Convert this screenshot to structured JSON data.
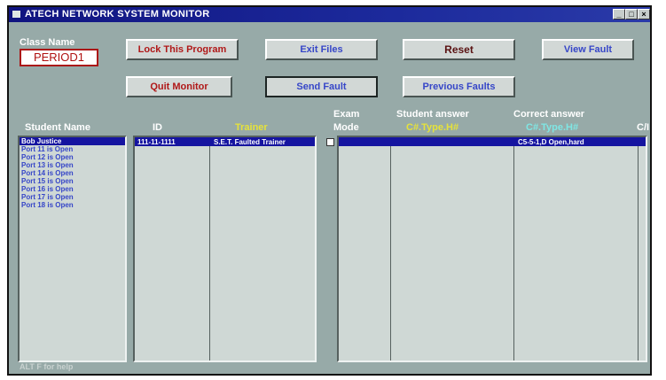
{
  "window": {
    "title": "ATECH NETWORK SYSTEM MONITOR"
  },
  "class_name": {
    "label": "Class Name",
    "value": "PERIOD1"
  },
  "buttons": {
    "lock": "Lock This Program",
    "exit_files": "Exit Files",
    "reset": "Reset",
    "view_fault": "View Fault",
    "quit": "Quit Monitor",
    "send_fault": "Send Fault",
    "previous_faults": "Previous Faults"
  },
  "headers": {
    "student_name": "Student Name",
    "id": "ID",
    "trainer": "Trainer",
    "exam": "Exam",
    "mode": "Mode",
    "student_answer": "Student answer",
    "student_answer_sub": "C#.Type.H#",
    "correct_answer": "Correct answer",
    "correct_answer_sub": "C#.Type.H#",
    "ca": "C/I"
  },
  "students": [
    "Bob Justice",
    "Port 11 is Open",
    "Port 12 is Open",
    "Port 13 is Open",
    "Port 14 is Open",
    "Port 15 is Open",
    "Port 16 is Open",
    "Port 17 is Open",
    "Port 18 is Open"
  ],
  "selected_row": {
    "id": "111-11-1111",
    "trainer": "S.E.T. Faulted Trainer",
    "correct_answer": "C5-5-1,D Open,hard"
  },
  "status_bar": "ALT F for help"
}
